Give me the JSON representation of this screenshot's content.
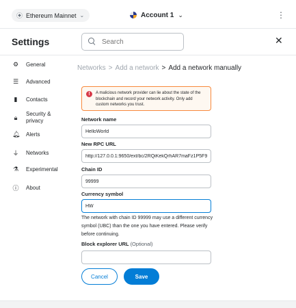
{
  "topbar": {
    "network_label": "Ethereum Mainnet",
    "account_label": "Account 1",
    "network_icon": "ethereum-icon",
    "menu_icon": "kebab-menu-icon"
  },
  "settings": {
    "title": "Settings",
    "search_placeholder": "Search"
  },
  "sidebar": {
    "items": [
      {
        "label": "General",
        "icon": "gear-icon"
      },
      {
        "label": "Advanced",
        "icon": "sliders-icon"
      },
      {
        "label": "Contacts",
        "icon": "contacts-book-icon"
      },
      {
        "label": "Security & privacy",
        "icon": "lock-icon"
      },
      {
        "label": "Alerts",
        "icon": "bell-icon"
      },
      {
        "label": "Networks",
        "icon": "plug-icon"
      },
      {
        "label": "Experimental",
        "icon": "flask-icon"
      },
      {
        "label": "About",
        "icon": "info-icon"
      }
    ]
  },
  "breadcrumb": {
    "part1": "Networks",
    "sep1": ">",
    "part2": "Add a network",
    "sep2": ">",
    "current": "Add a network manually"
  },
  "warning": {
    "text": "A malicious network provider can lie about the state of the blockchain and record your network activity. Only add custom networks you trust."
  },
  "form": {
    "network_name_label": "Network name",
    "network_name_value": "HelloWorld",
    "rpc_url_label": "New RPC URL",
    "rpc_url_value": "http://127.0.0.1:9650/ext/bc/2RQiKekQrhAR7maFz1P5F9",
    "chain_id_label": "Chain ID",
    "chain_id_value": "99999",
    "currency_symbol_label": "Currency symbol",
    "currency_symbol_value": "HW",
    "currency_helper": "The network with chain ID 99999 may use a different currency symbol (UBC) than the one you have entered. Please verify before continuing.",
    "block_explorer_label": "Block explorer URL",
    "block_explorer_optional": "(Optional)",
    "block_explorer_value": ""
  },
  "buttons": {
    "cancel": "Cancel",
    "save": "Save"
  },
  "colors": {
    "primary": "#037dd6",
    "warning_border": "#f8883b",
    "warning_bg": "#fef8f1",
    "error": "#d73a49"
  }
}
